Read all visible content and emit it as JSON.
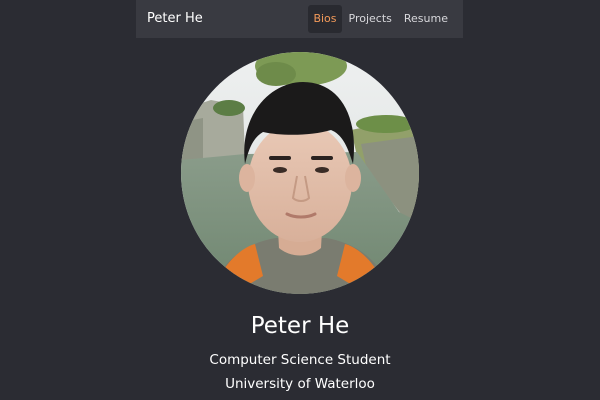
{
  "navbar": {
    "brand": "Peter He",
    "links": [
      {
        "label": "Bios",
        "active": true
      },
      {
        "label": "Projects",
        "active": false
      },
      {
        "label": "Resume",
        "active": false
      }
    ]
  },
  "profile": {
    "name": "Peter He",
    "title": "Computer Science Student",
    "school": "University of Waterloo"
  },
  "colors": {
    "background": "#2b2c33",
    "navbar": "#393a41",
    "accent": "#f39a5a"
  }
}
